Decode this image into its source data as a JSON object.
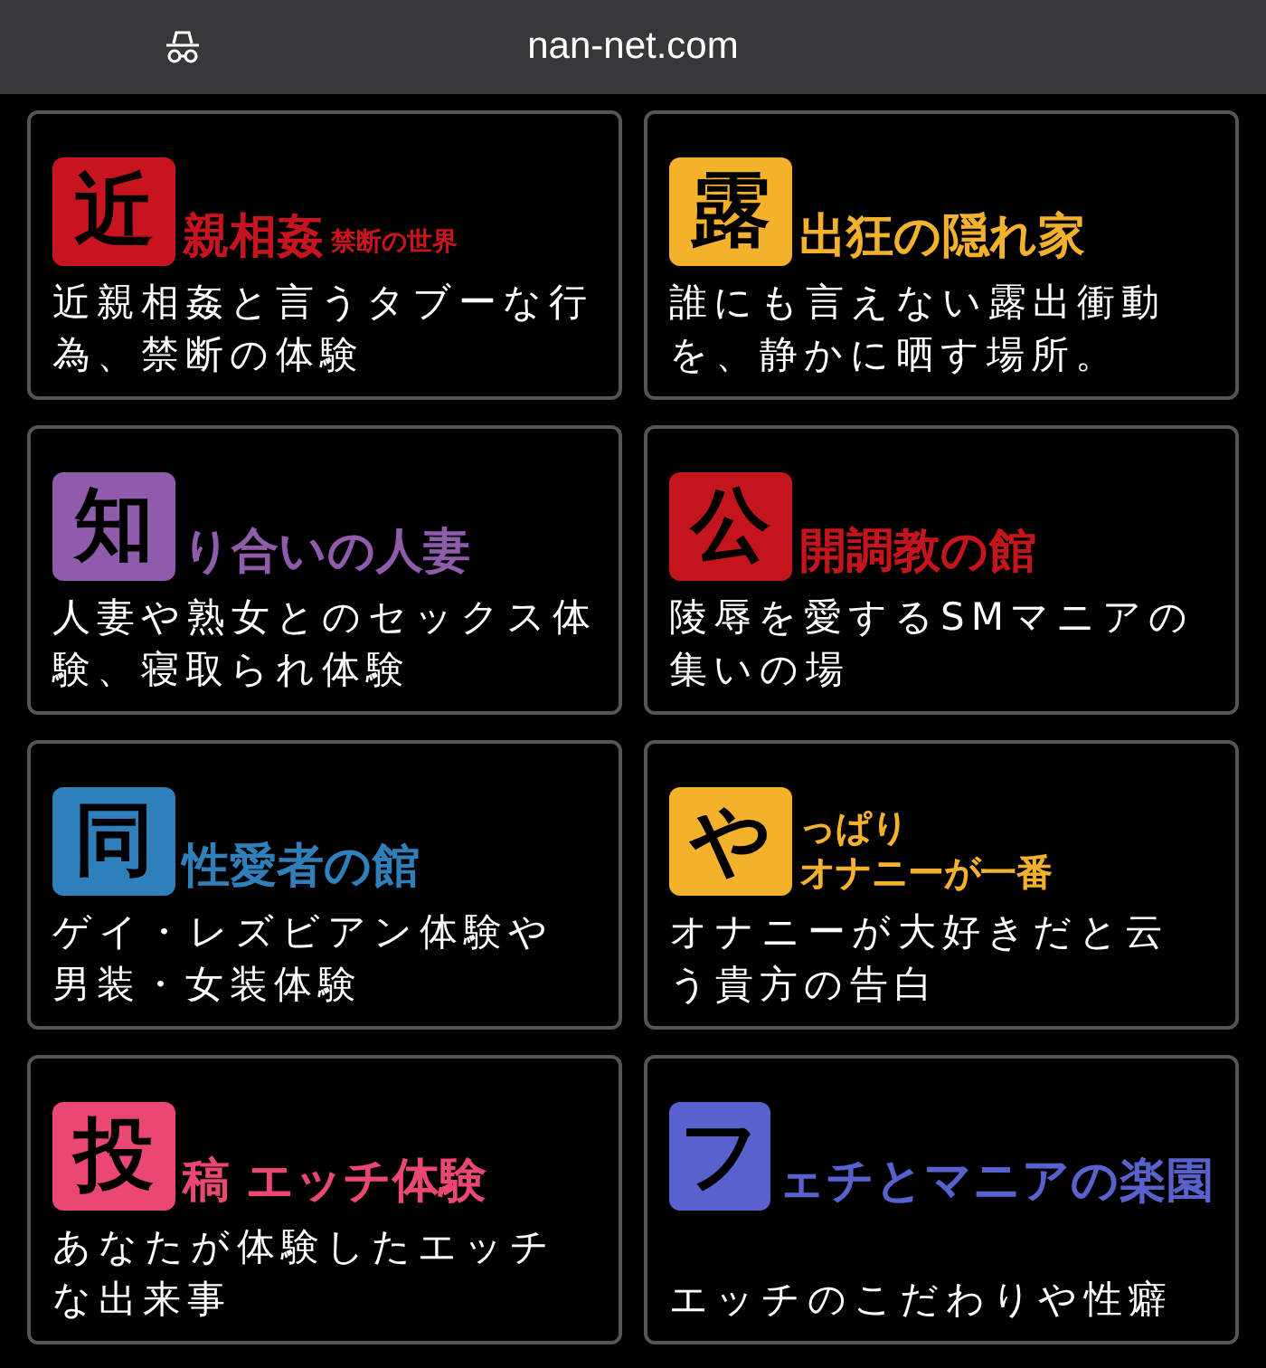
{
  "address_bar": {
    "url": "nan-net.com"
  },
  "cards": [
    {
      "initial": "近",
      "title_lines": [
        "親相姦"
      ],
      "subtitle": "禁断の世界",
      "color": "#c8141e",
      "description": "近親相姦と言うタブーな行為、禁断の体験"
    },
    {
      "initial": "露",
      "title_lines": [
        "出狂の隠れ家"
      ],
      "color": "#f4b22c",
      "description": "誰にも言えない露出衝動を、静かに晒す場所。"
    },
    {
      "initial": "知",
      "title_lines": [
        "り合いの人妻"
      ],
      "color": "#8e5cab",
      "description": "人妻や熟女とのセックス体験、寝取られ体験"
    },
    {
      "initial": "公",
      "title_lines": [
        "開調教の館"
      ],
      "color": "#c4141c",
      "description": "陵辱を愛するSMマニアの集いの場"
    },
    {
      "initial": "同",
      "title_lines": [
        "性愛者の館"
      ],
      "color": "#2f80ba",
      "description": "ゲイ・レズビアン体験や男装・女装体験"
    },
    {
      "initial": "や",
      "title_lines": [
        "っぱり",
        "オナニーが一番"
      ],
      "color": "#f4b22c",
      "description": "オナニーが大好きだと云う貴方の告白"
    },
    {
      "initial": "投",
      "title_lines": [
        "稿 エッチ体験"
      ],
      "color": "#ea4872",
      "description": "あなたが体験したエッチな出来事"
    },
    {
      "initial": "フ",
      "title_lines": [
        "ェチとマニアの楽園"
      ],
      "color": "#5862cc",
      "description": "エッチのこだわりや性癖"
    }
  ]
}
